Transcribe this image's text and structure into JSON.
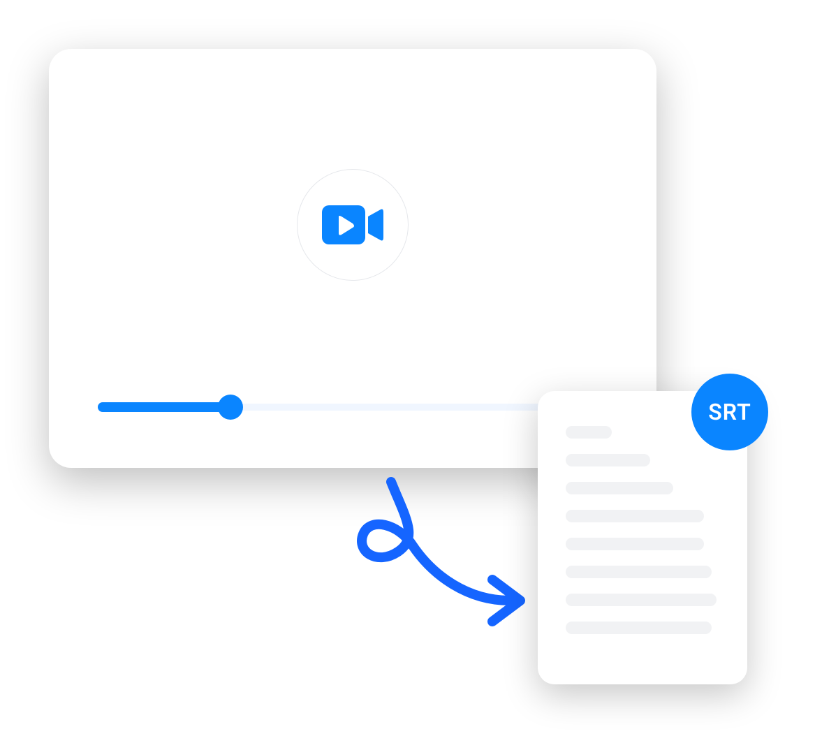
{
  "video": {
    "progress_percent": 26
  },
  "document": {
    "badge_label": "SRT"
  },
  "colors": {
    "accent": "#0a85ff"
  }
}
